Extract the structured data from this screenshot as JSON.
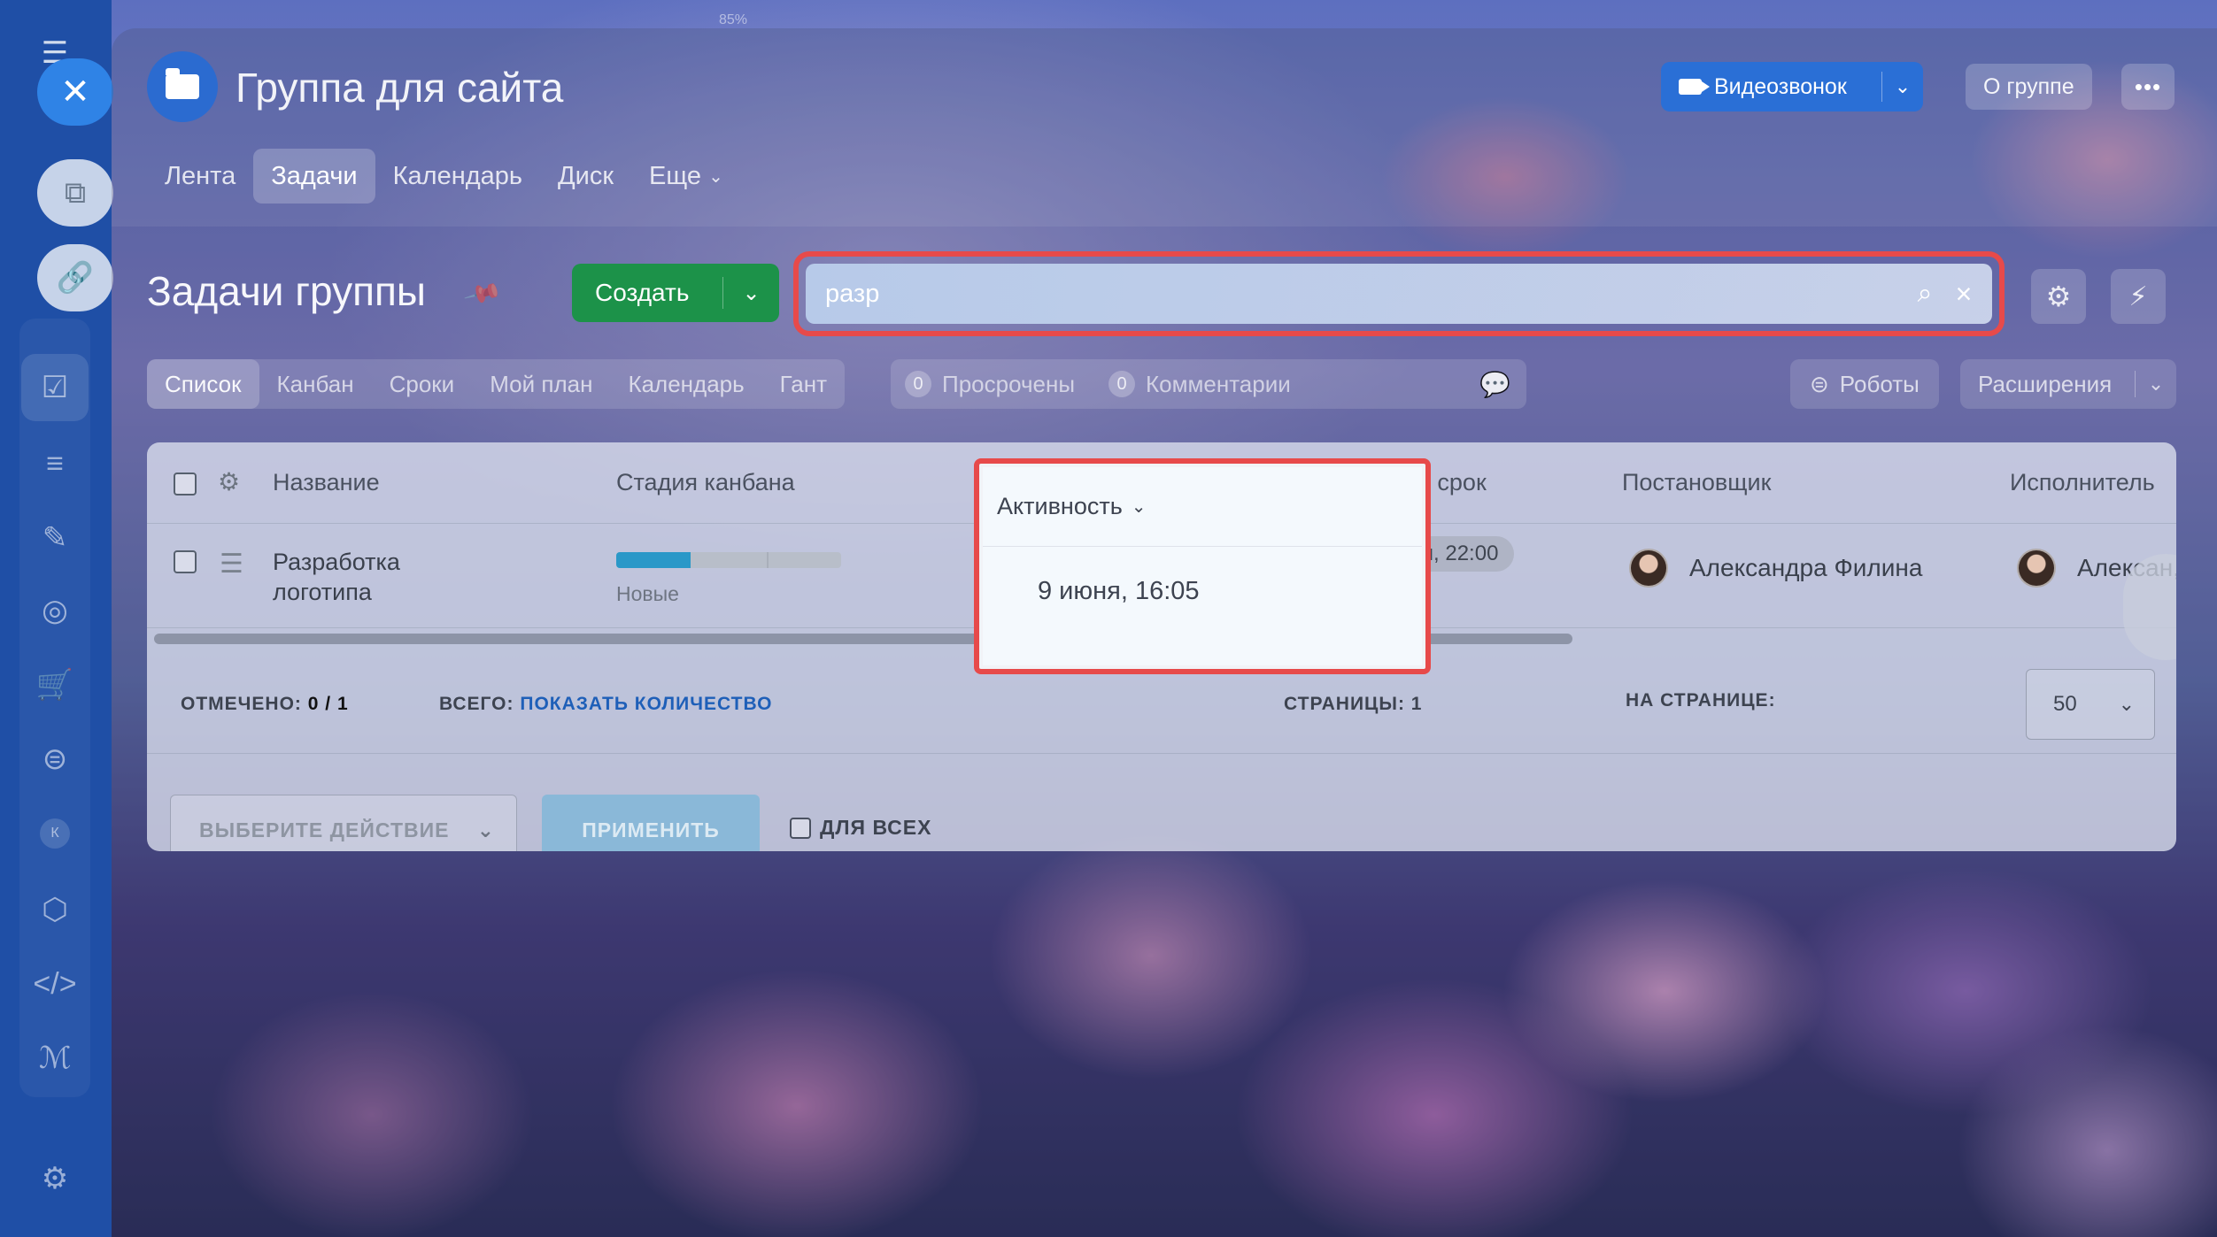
{
  "zoom": "85%",
  "group": {
    "title": "Группа для сайта"
  },
  "header": {
    "video_call": "Видеозвонок",
    "about": "О группе",
    "more": "•••"
  },
  "nav": [
    "Лента",
    "Задачи",
    "Календарь",
    "Диск",
    "Еще"
  ],
  "nav_active": "Задачи",
  "page": {
    "title": "Задачи группы",
    "create": "Создать"
  },
  "search": {
    "value": "разр"
  },
  "view_tabs": [
    "Список",
    "Канбан",
    "Сроки",
    "Мой план",
    "Календарь",
    "Гант"
  ],
  "view_active": "Список",
  "counters": [
    {
      "num": "0",
      "label": "Просрочены"
    },
    {
      "num": "0",
      "label": "Комментарии"
    }
  ],
  "robots": "Роботы",
  "extensions": "Расширения",
  "grid": {
    "columns": {
      "name": "Название",
      "stage": "Стадия канбана",
      "activity": "Активность",
      "deadline": "Крайний срок",
      "creator": "Постановщик",
      "responsible": "Исполнитель"
    },
    "rows": [
      {
        "name": "Разработка логотипа",
        "stage": "Новые",
        "stage_progress": 0.33,
        "activity": "9 июня, 16:05",
        "deadline": "24 июня, 22:00",
        "creator": "Александра Филина",
        "responsible": "Алексан,"
      }
    ],
    "footer": {
      "checked_label": "ОТМЕЧЕНО:",
      "checked_value": "0 / 1",
      "total_label": "ВСЕГО:",
      "total_link": "ПОКАЗАТЬ КОЛИЧЕСТВО",
      "pages_label": "СТРАНИЦЫ:",
      "pages_value": "1",
      "per_page_label": "НА СТРАНИЦЕ:",
      "per_page_value": "50"
    },
    "actions": {
      "select_placeholder": "ВЫБЕРИТЕ ДЕЙСТВИЕ",
      "apply": "ПРИМЕНИТЬ",
      "for_all": "ДЛЯ ВСЕХ"
    }
  },
  "sidebar": {
    "avatar_letter": "К"
  },
  "colors": {
    "highlight": "#e74a4a",
    "create_button": "#1c9249",
    "video_button": "#2a6fd6",
    "stage_fill": "#2a98c8"
  }
}
